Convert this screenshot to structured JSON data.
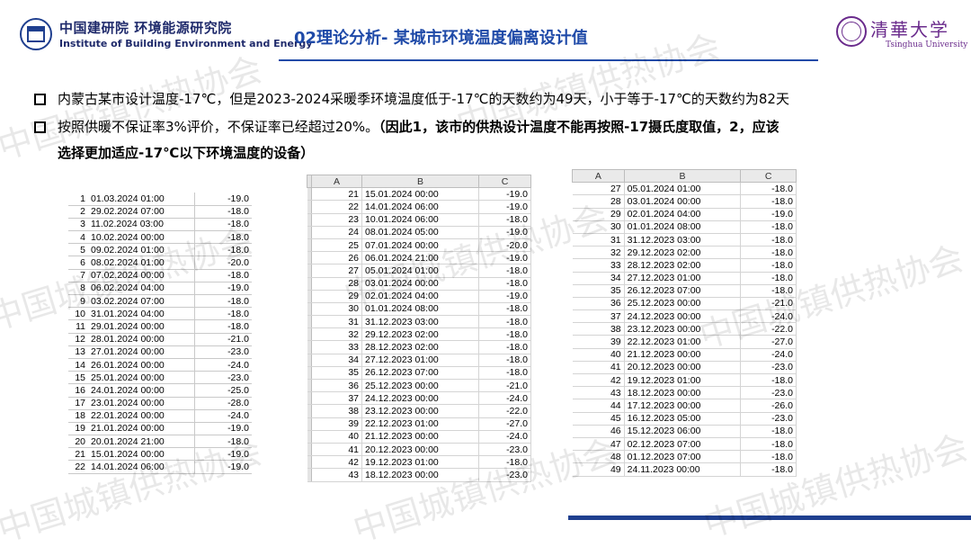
{
  "header": {
    "institute_cn": "中国建研院  环境能源研究院",
    "institute_en": "Institute of Building Environment and Energy",
    "title": "02理论分析- 某城市环境温度偏离设计值",
    "university_cn": "清華大学",
    "university_en": "Tsinghua University"
  },
  "watermark": {
    "text": "中国城镇供热协会"
  },
  "bullets": [
    {
      "text": "内蒙古某市设计温度-17℃，但是2023-2024采暖季环境温度低于-17℃的天数约为49天，小于等于-17℃的天数约为82天"
    },
    {
      "text": "按照供暖不保证率3%评价，不保证率已经超过20%。",
      "bold_text": "（因此1，该市的供热设计温度不能再按照-17摄氏度取值，2，应该",
      "line2": "选择更加适应-17℃以下环境温度的设备）"
    }
  ],
  "table1": {
    "rows": [
      [
        "1",
        "01.03.2024 01:00",
        "-19.0"
      ],
      [
        "2",
        "29.02.2024 07:00",
        "-18.0"
      ],
      [
        "3",
        "11.02.2024 03:00",
        "-18.0"
      ],
      [
        "4",
        "10.02.2024 00:00",
        "-18.0"
      ],
      [
        "5",
        "09.02.2024 01:00",
        "-18.0"
      ],
      [
        "6",
        "08.02.2024 01:00",
        "-20.0"
      ],
      [
        "7",
        "07.02.2024 00:00",
        "-18.0"
      ],
      [
        "8",
        "06.02.2024 04:00",
        "-19.0"
      ],
      [
        "9",
        "03.02.2024 07:00",
        "-18.0"
      ],
      [
        "10",
        "31.01.2024 04:00",
        "-18.0"
      ],
      [
        "11",
        "29.01.2024 00:00",
        "-18.0"
      ],
      [
        "12",
        "28.01.2024 00:00",
        "-21.0"
      ],
      [
        "13",
        "27.01.2024 00:00",
        "-23.0"
      ],
      [
        "14",
        "26.01.2024 00:00",
        "-24.0"
      ],
      [
        "15",
        "25.01.2024 00:00",
        "-23.0"
      ],
      [
        "16",
        "24.01.2024 00:00",
        "-25.0"
      ],
      [
        "17",
        "23.01.2024 00:00",
        "-28.0"
      ],
      [
        "18",
        "22.01.2024 00:00",
        "-24.0"
      ],
      [
        "19",
        "21.01.2024 00:00",
        "-19.0"
      ],
      [
        "20",
        "20.01.2024 21:00",
        "-18.0"
      ],
      [
        "21",
        "15.01.2024 00:00",
        "-19.0"
      ],
      [
        "22",
        "14.01.2024 06:00",
        "-19.0"
      ]
    ]
  },
  "table2": {
    "headers": [
      "A",
      "B",
      "C"
    ],
    "rows": [
      [
        "21",
        "15.01.2024 00:00",
        "-19.0"
      ],
      [
        "22",
        "14.01.2024 06:00",
        "-19.0"
      ],
      [
        "23",
        "10.01.2024 06:00",
        "-18.0"
      ],
      [
        "24",
        "08.01.2024 05:00",
        "-19.0"
      ],
      [
        "25",
        "07.01.2024 00:00",
        "-20.0"
      ],
      [
        "26",
        "06.01.2024 21:00",
        "-19.0"
      ],
      [
        "27",
        "05.01.2024 01:00",
        "-18.0"
      ],
      [
        "28",
        "03.01.2024 00:00",
        "-18.0"
      ],
      [
        "29",
        "02.01.2024 04:00",
        "-19.0"
      ],
      [
        "30",
        "01.01.2024 08:00",
        "-18.0"
      ],
      [
        "31",
        "31.12.2023 03:00",
        "-18.0"
      ],
      [
        "32",
        "29.12.2023 02:00",
        "-18.0"
      ],
      [
        "33",
        "28.12.2023 02:00",
        "-18.0"
      ],
      [
        "34",
        "27.12.2023 01:00",
        "-18.0"
      ],
      [
        "35",
        "26.12.2023 07:00",
        "-18.0"
      ],
      [
        "36",
        "25.12.2023 00:00",
        "-21.0"
      ],
      [
        "37",
        "24.12.2023 00:00",
        "-24.0"
      ],
      [
        "38",
        "23.12.2023 00:00",
        "-22.0"
      ],
      [
        "39",
        "22.12.2023 01:00",
        "-27.0"
      ],
      [
        "40",
        "21.12.2023 00:00",
        "-24.0"
      ],
      [
        "41",
        "20.12.2023 00:00",
        "-23.0"
      ],
      [
        "42",
        "19.12.2023 01:00",
        "-18.0"
      ],
      [
        "43",
        "18.12.2023 00:00",
        "-23.0"
      ]
    ]
  },
  "table3": {
    "headers": [
      "A",
      "B",
      "C"
    ],
    "rows": [
      [
        "27",
        "05.01.2024 01:00",
        "-18.0"
      ],
      [
        "28",
        "03.01.2024 00:00",
        "-18.0"
      ],
      [
        "29",
        "02.01.2024 04:00",
        "-19.0"
      ],
      [
        "30",
        "01.01.2024 08:00",
        "-18.0"
      ],
      [
        "31",
        "31.12.2023 03:00",
        "-18.0"
      ],
      [
        "32",
        "29.12.2023 02:00",
        "-18.0"
      ],
      [
        "33",
        "28.12.2023 02:00",
        "-18.0"
      ],
      [
        "34",
        "27.12.2023 01:00",
        "-18.0"
      ],
      [
        "35",
        "26.12.2023 07:00",
        "-18.0"
      ],
      [
        "36",
        "25.12.2023 00:00",
        "-21.0"
      ],
      [
        "37",
        "24.12.2023 00:00",
        "-24.0"
      ],
      [
        "38",
        "23.12.2023 00:00",
        "-22.0"
      ],
      [
        "39",
        "22.12.2023 01:00",
        "-27.0"
      ],
      [
        "40",
        "21.12.2023 00:00",
        "-24.0"
      ],
      [
        "41",
        "20.12.2023 00:00",
        "-23.0"
      ],
      [
        "42",
        "19.12.2023 01:00",
        "-18.0"
      ],
      [
        "43",
        "18.12.2023 00:00",
        "-23.0"
      ],
      [
        "44",
        "17.12.2023 00:00",
        "-26.0"
      ],
      [
        "45",
        "16.12.2023 05:00",
        "-23.0"
      ],
      [
        "46",
        "15.12.2023 06:00",
        "-18.0"
      ],
      [
        "47",
        "02.12.2023 07:00",
        "-18.0"
      ],
      [
        "48",
        "01.12.2023 07:00",
        "-18.0"
      ],
      [
        "49",
        "24.11.2023 00:00",
        "-18.0"
      ]
    ]
  },
  "colors": {
    "title_blue": "#1f4aa8",
    "institute_navy": "#1f2a6b",
    "tsinghua_purple": "#6a2b8c",
    "bottom_bar": "#1f3f8f"
  }
}
